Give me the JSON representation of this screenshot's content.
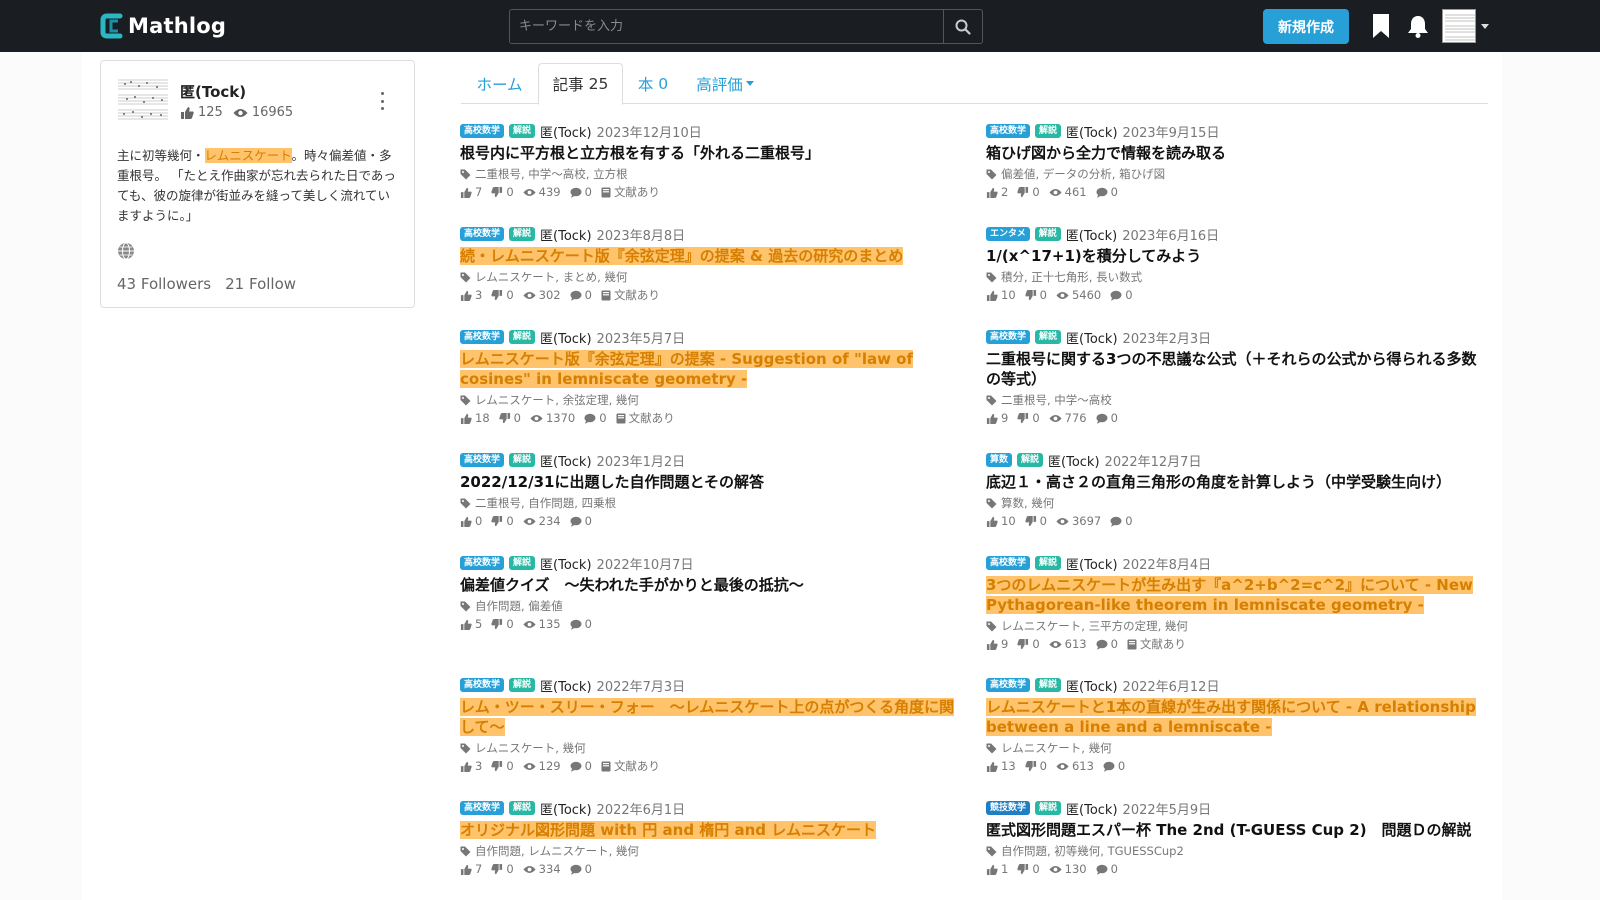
{
  "navbar": {
    "logo_text": "Mathlog",
    "search_placeholder": "キーワードを入力",
    "new_button": "新規作成",
    "colors": {
      "background": "#1a1d21",
      "accent": "#27a0d8"
    }
  },
  "profile": {
    "name": "匿(Tock)",
    "likes": "125",
    "views": "16965",
    "bio_before": "主に初等幾何・",
    "bio_highlight": "レムニスケート",
    "bio_after": "。時々偏差値・多重根号。 「たとえ作曲家が忘れ去られた日であっても、彼の旋律が街並みを縫って美しく流れていますように。」",
    "followers": "43 Followers",
    "follow": "21 Follow"
  },
  "tabs": {
    "home": "ホーム",
    "articles": "記事",
    "articles_count": "25",
    "books": "本",
    "books_count": "0",
    "top_rated": "高評価"
  },
  "articles": [
    {
      "badges": [
        "高校数学",
        "解説"
      ],
      "author": "匿(Tock)",
      "date": "2023年12月10日",
      "title": "根号内に平方根と立方根を有する「外れる二重根号」",
      "highlight": false,
      "tags": "二重根号, 中学～高校, 立方根",
      "likes": "7",
      "dislikes": "0",
      "views": "439",
      "comments": "0",
      "refs": "文献あり"
    },
    {
      "badges": [
        "高校数学",
        "解説"
      ],
      "author": "匿(Tock)",
      "date": "2023年9月15日",
      "title": "箱ひげ図から全力で情報を読み取る",
      "highlight": false,
      "tags": "偏差値, データの分析, 箱ひげ図",
      "likes": "2",
      "dislikes": "0",
      "views": "461",
      "comments": "0",
      "refs": ""
    },
    {
      "badges": [
        "高校数学",
        "解説"
      ],
      "author": "匿(Tock)",
      "date": "2023年8月8日",
      "title": "続・レムニスケート版『余弦定理』の提案 & 過去の研究のまとめ",
      "highlight": true,
      "tags": "レムニスケート, まとめ, 幾何",
      "likes": "3",
      "dislikes": "0",
      "views": "302",
      "comments": "0",
      "refs": "文献あり"
    },
    {
      "badges": [
        "エンタメ",
        "解説"
      ],
      "author": "匿(Tock)",
      "date": "2023年6月16日",
      "title": "1/(x^17+1)を積分してみよう",
      "highlight": false,
      "tags": "積分, 正十七角形, 長い数式",
      "likes": "10",
      "dislikes": "0",
      "views": "5460",
      "comments": "0",
      "refs": ""
    },
    {
      "badges": [
        "高校数学",
        "解説"
      ],
      "author": "匿(Tock)",
      "date": "2023年5月7日",
      "title": "レムニスケート版『余弦定理』の提案 - Suggestion of \"law of cosines\" in lemniscate geometry -",
      "highlight": true,
      "tags": "レムニスケート, 余弦定理, 幾何",
      "likes": "18",
      "dislikes": "0",
      "views": "1370",
      "comments": "0",
      "refs": "文献あり"
    },
    {
      "badges": [
        "高校数学",
        "解説"
      ],
      "author": "匿(Tock)",
      "date": "2023年2月3日",
      "title": "二重根号に関する3つの不思議な公式（＋それらの公式から得られる多数の等式）",
      "highlight": false,
      "tags": "二重根号, 中学～高校",
      "likes": "9",
      "dislikes": "0",
      "views": "776",
      "comments": "0",
      "refs": ""
    },
    {
      "badges": [
        "高校数学",
        "解説"
      ],
      "author": "匿(Tock)",
      "date": "2023年1月2日",
      "title": "2022/12/31に出題した自作問題とその解答",
      "highlight": false,
      "tags": "二重根号, 自作問題, 四乗根",
      "likes": "0",
      "dislikes": "0",
      "views": "234",
      "comments": "0",
      "refs": ""
    },
    {
      "badges": [
        "算数",
        "解説"
      ],
      "author": "匿(Tock)",
      "date": "2022年12月7日",
      "title": "底辺１・高さ２の直角三角形の角度を計算しよう（中学受験生向け）",
      "highlight": false,
      "tags": "算数, 幾何",
      "likes": "10",
      "dislikes": "0",
      "views": "3697",
      "comments": "0",
      "refs": ""
    },
    {
      "badges": [
        "高校数学",
        "解説"
      ],
      "author": "匿(Tock)",
      "date": "2022年10月7日",
      "title": "偏差値クイズ　～失われた手がかりと最後の抵抗～",
      "highlight": false,
      "tags": "自作問題, 偏差値",
      "likes": "5",
      "dislikes": "0",
      "views": "135",
      "comments": "0",
      "refs": ""
    },
    {
      "badges": [
        "高校数学",
        "解説"
      ],
      "author": "匿(Tock)",
      "date": "2022年8月4日",
      "title": "3つのレムニスケートが生み出す『a^2+b^2=c^2』について - New Pythagorean-like theorem in lemniscate geometry -",
      "highlight": true,
      "tags": "レムニスケート, 三平方の定理, 幾何",
      "likes": "9",
      "dislikes": "0",
      "views": "613",
      "comments": "0",
      "refs": "文献あり"
    },
    {
      "badges": [
        "高校数学",
        "解説"
      ],
      "author": "匿(Tock)",
      "date": "2022年7月3日",
      "title": "レム・ツー・スリー・フォー　～レムニスケート上の点がつくる角度に関して～",
      "highlight": true,
      "tags": "レムニスケート, 幾何",
      "likes": "3",
      "dislikes": "0",
      "views": "129",
      "comments": "0",
      "refs": "文献あり"
    },
    {
      "badges": [
        "高校数学",
        "解説"
      ],
      "author": "匿(Tock)",
      "date": "2022年6月12日",
      "title": "レムニスケートと1本の直線が生み出す関係について - A relationship between a line and a lemniscate -",
      "highlight": true,
      "tags": "レムニスケート, 幾何",
      "likes": "13",
      "dislikes": "0",
      "views": "613",
      "comments": "0",
      "refs": ""
    },
    {
      "badges": [
        "高校数学",
        "解説"
      ],
      "author": "匿(Tock)",
      "date": "2022年6月1日",
      "title": "オリジナル図形問題 with 円 and 楕円 and レムニスケート",
      "highlight": true,
      "tags": "自作問題, レムニスケート, 幾何",
      "likes": "7",
      "dislikes": "0",
      "views": "334",
      "comments": "0",
      "refs": ""
    },
    {
      "badges": [
        "競技数学",
        "解説"
      ],
      "author": "匿(Tock)",
      "date": "2022年5月9日",
      "title": "匿式図形問題エスパー杯 The 2nd (T-GUESS Cup 2)　問題Ｄの解説",
      "highlight": false,
      "tags": "自作問題, 初等幾何, TGUESSCup2",
      "likes": "1",
      "dislikes": "0",
      "views": "130",
      "comments": "0",
      "refs": ""
    }
  ]
}
